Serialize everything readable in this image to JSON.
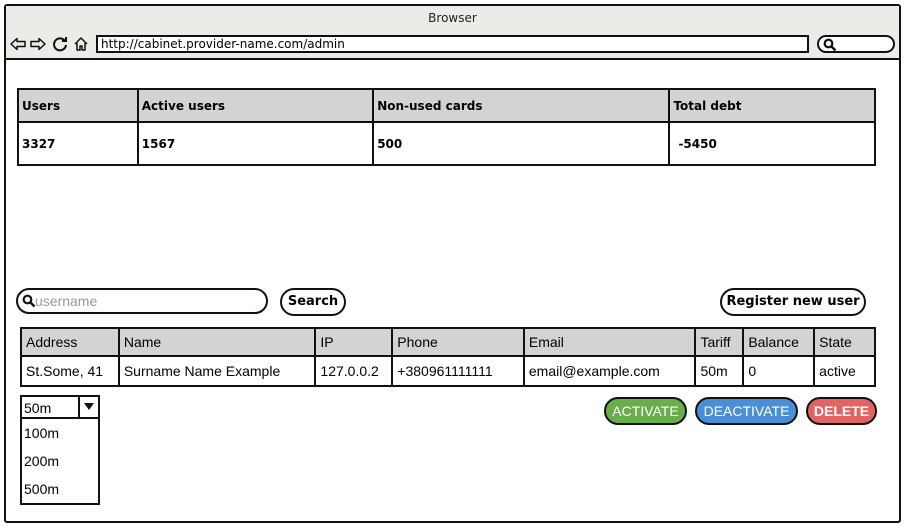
{
  "colors": {
    "header_gray": "#d3d3d3",
    "chrome": "#ecebe8",
    "activate": "#6aae4c",
    "deactivate": "#4a8fd6",
    "delete": "#e06464"
  },
  "browser": {
    "title": "Browser",
    "url": "http://cabinet.provider-name.com/admin",
    "icons": [
      "back-arrow-icon",
      "forward-arrow-icon",
      "reload-icon",
      "home-icon",
      "search-icon"
    ]
  },
  "stats": {
    "headers": [
      "Users",
      "Active users",
      "Non-used cards",
      "Total debt"
    ],
    "values": [
      "3327",
      "1567",
      "500",
      "-5450"
    ]
  },
  "search": {
    "placeholder": "username",
    "button_label": "Search"
  },
  "register_button_label": "Register new user",
  "users_table": {
    "headers": [
      "Address",
      "Name",
      "IP",
      "Phone",
      "Email",
      "Tariff",
      "Balance",
      "State"
    ],
    "rows": [
      [
        "St.Some, 41",
        "Surname Name Example",
        "127.0.0.2",
        "+380961111111",
        "email@example.com",
        "50m",
        "0",
        "active"
      ]
    ]
  },
  "tariff_select": {
    "selected": "50m",
    "options": [
      "100m",
      "200m",
      "500m"
    ]
  },
  "actions": {
    "activate": "ACTIVATE",
    "deactivate": "DEACTIVATE",
    "delete": "DELETE"
  }
}
